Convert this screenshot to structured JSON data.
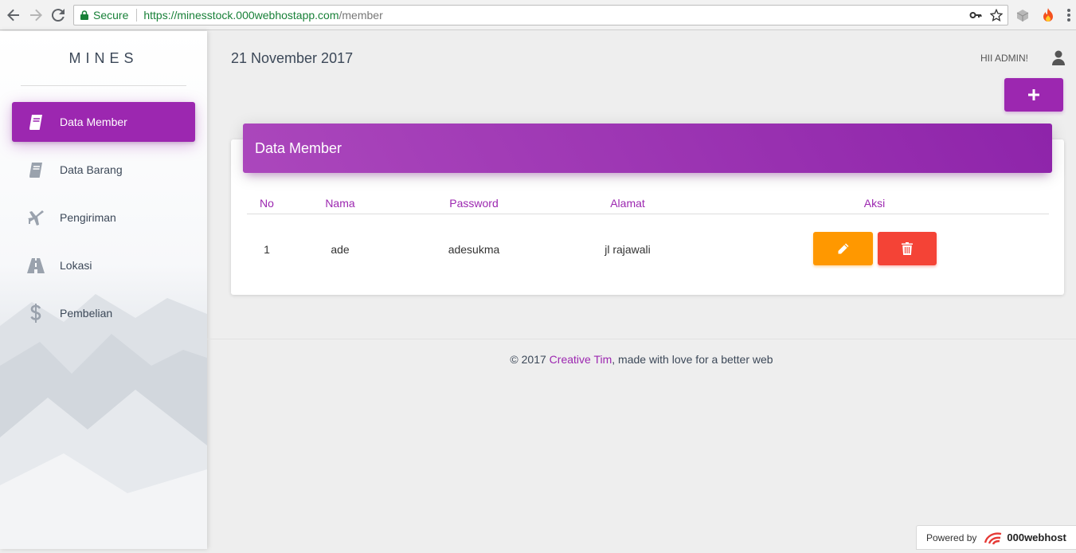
{
  "browser": {
    "secure_label": "Secure",
    "url_host": "https://minesstock.000webhostapp.com",
    "url_path": "/member"
  },
  "sidebar": {
    "brand": "MINES",
    "items": [
      {
        "label": "Data Member",
        "icon": "book-icon",
        "active": true
      },
      {
        "label": "Data Barang",
        "icon": "book-icon",
        "active": false
      },
      {
        "label": "Pengiriman",
        "icon": "airplane-icon",
        "active": false
      },
      {
        "label": "Lokasi",
        "icon": "road-icon",
        "active": false
      },
      {
        "label": "Pembelian",
        "icon": "dollar-icon",
        "active": false
      }
    ]
  },
  "header": {
    "date": "21 November 2017",
    "greeting": "HII ADMIN!"
  },
  "card": {
    "title": "Data Member",
    "columns": [
      "No",
      "Nama",
      "Password",
      "Alamat",
      "Aksi"
    ],
    "rows": [
      {
        "no": "1",
        "nama": "ade",
        "password": "adesukma",
        "alamat": "jl rajawali"
      }
    ]
  },
  "footer": {
    "prefix": "© 2017",
    "link": "Creative Tim",
    "suffix": ", made with love for a better web"
  },
  "powered": {
    "label": "Powered by",
    "brand": "000webhost"
  },
  "colors": {
    "accent": "#9c27b0",
    "edit": "#ff9800",
    "delete": "#f44336"
  }
}
